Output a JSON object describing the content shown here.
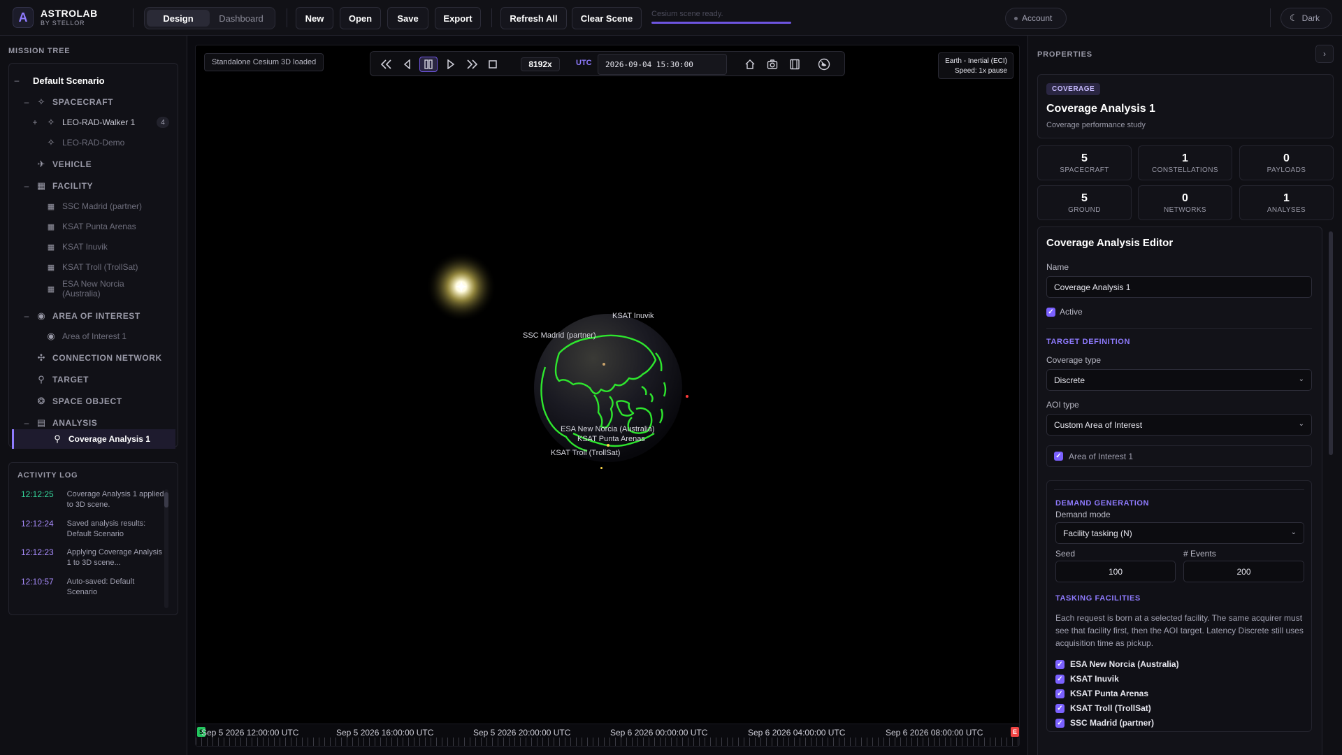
{
  "app": {
    "name": "ASTROLAB",
    "sub": "BY STELLOR"
  },
  "header": {
    "modes": [
      "Design",
      "Dashboard"
    ],
    "buttons": {
      "new": "New",
      "open": "Open",
      "save": "Save",
      "export": "Export",
      "refresh": "Refresh All",
      "clear": "Clear Scene"
    },
    "status": "Cesium scene ready.",
    "status_progress": 1.0,
    "account": "Account",
    "theme": "Dark"
  },
  "mission_tree": {
    "title": "MISSION TREE",
    "root": "Default Scenario",
    "spacecraft": "SPACECRAFT",
    "sc_items": [
      "LEO-RAD-Walker 1",
      "LEO-RAD-Demo"
    ],
    "sc_badge": "4",
    "vehicle": "VEHICLE",
    "facility": "FACILITY",
    "facilities": [
      "SSC Madrid (partner)",
      "KSAT Punta Arenas",
      "KSAT Inuvik",
      "KSAT Troll (TrollSat)",
      "ESA New Norcia (Australia)"
    ],
    "aoi": "AREA OF INTEREST",
    "aoi_items": [
      "Area of Interest 1"
    ],
    "connection": "CONNECTION NETWORK",
    "target": "TARGET",
    "space_object": "SPACE OBJECT",
    "analysis": "ANALYSIS",
    "analysis_items": [
      "Coverage Analysis 1"
    ]
  },
  "activity_log": {
    "title": "ACTIVITY LOG",
    "entries": [
      {
        "time": "12:12:25",
        "msg": "Coverage Analysis 1 applied to 3D scene.",
        "color": "#34d399"
      },
      {
        "time": "12:12:24",
        "msg": "Saved analysis results: Default Scenario",
        "color": "#a78bfa"
      },
      {
        "time": "12:12:23",
        "msg": "Applying Coverage Analysis 1 to 3D scene...",
        "color": "#a78bfa"
      },
      {
        "time": "12:10:57",
        "msg": "Auto-saved: Default Scenario",
        "color": "#a78bfa"
      }
    ]
  },
  "viewport": {
    "loaded": "Standalone Cesium 3D loaded",
    "speed": "8192x",
    "utc_label": "UTC",
    "time": "2026-09-04 15:30:00",
    "frame": "Earth - Inertial (ECI)",
    "frame_speed": "Speed: 1x pause",
    "labels": {
      "inuvik": "KSAT Inuvik",
      "madrid": "SSC Madrid (partner)",
      "norcia": "ESA New Norcia (Australia)",
      "punta": "KSAT Punta Arenas",
      "troll": "KSAT Troll (TrollSat)"
    },
    "timeline": [
      "Sep 5 2026 12:00:00 UTC",
      "Sep 5 2026 16:00:00 UTC",
      "Sep 5 2026 20:00:00 UTC",
      "Sep 6 2026 00:00:00 UTC",
      "Sep 6 2026 04:00:00 UTC",
      "Sep 6 2026 08:00:00 UTC"
    ],
    "start_marker": "S",
    "end_marker": "E"
  },
  "properties": {
    "title": "PROPERTIES",
    "tag": "COVERAGE",
    "name": "Coverage Analysis 1",
    "desc": "Coverage performance study",
    "stats": [
      {
        "value": "5",
        "label": "SPACECRAFT"
      },
      {
        "value": "1",
        "label": "CONSTELLATIONS"
      },
      {
        "value": "0",
        "label": "PAYLOADS"
      },
      {
        "value": "5",
        "label": "GROUND"
      },
      {
        "value": "0",
        "label": "NETWORKS"
      },
      {
        "value": "1",
        "label": "ANALYSES"
      }
    ],
    "editor": {
      "title": "Coverage Analysis Editor",
      "name_label": "Name",
      "name_value": "Coverage Analysis 1",
      "active_label": "Active",
      "target_def": "TARGET DEFINITION",
      "coverage_type_label": "Coverage type",
      "coverage_type": "Discrete",
      "aoi_type_label": "AOI type",
      "aoi_type": "Custom Area of Interest",
      "aoi_item": "Area of Interest 1",
      "demand_gen": "DEMAND GENERATION",
      "demand_mode_label": "Demand mode",
      "demand_mode": "Facility tasking (N)",
      "seed_label": "Seed",
      "seed": "100",
      "events_label": "# Events",
      "events": "200",
      "tasking": "TASKING FACILITIES",
      "tasking_desc": "Each request is born at a selected facility. The same acquirer must see that facility first, then the AOI target. Latency Discrete still uses acquisition time as pickup.",
      "facilities": [
        "ESA New Norcia (Australia)",
        "KSAT Inuvik",
        "KSAT Punta Arenas",
        "KSAT Troll (TrollSat)",
        "SSC Madrid (partner)"
      ]
    }
  }
}
